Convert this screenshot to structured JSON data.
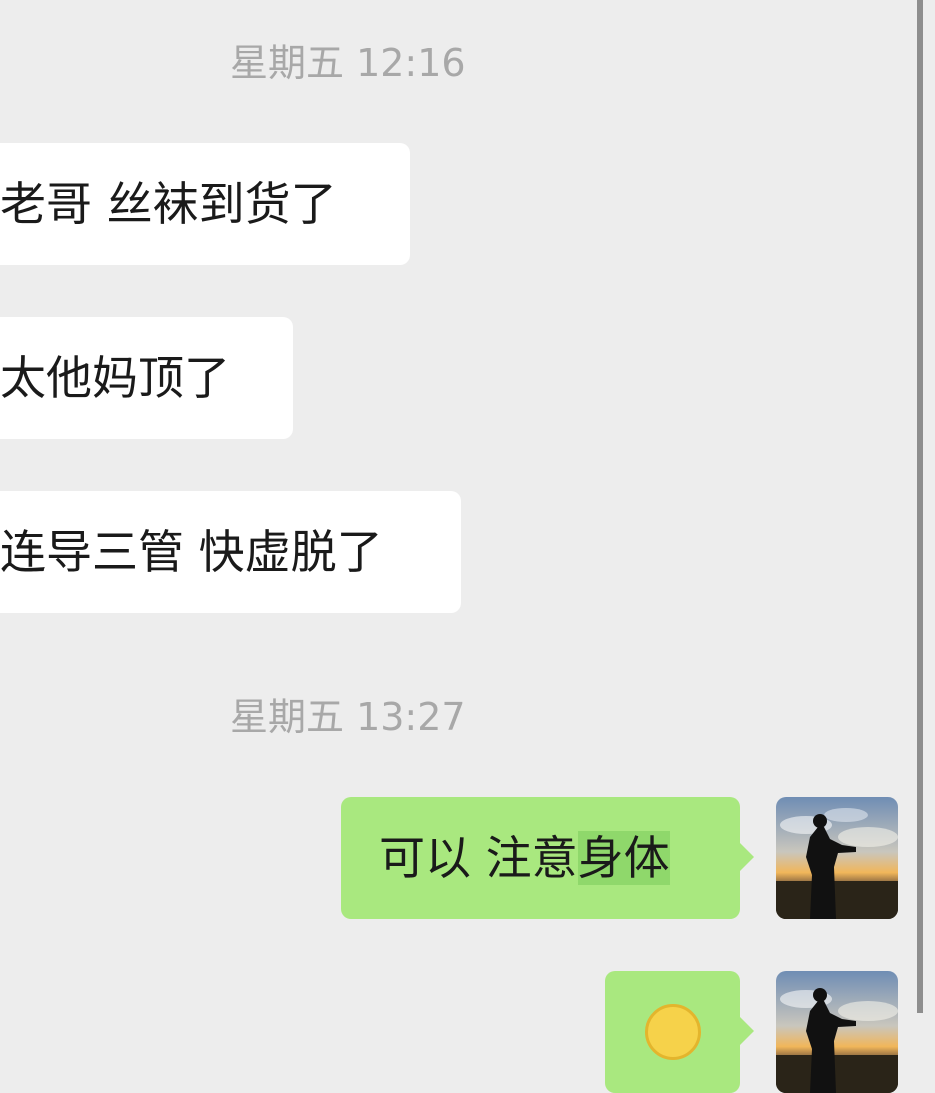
{
  "timestamps": {
    "first": "星期五 12:16",
    "second": "星期五 13:27"
  },
  "messages": {
    "incoming": [
      "老哥 丝袜到货了",
      "太他妈顶了",
      "连导三管 快虚脱了"
    ],
    "outgoing": {
      "text_plain": "可以 注意",
      "text_selected": "身体"
    }
  },
  "avatar": {
    "icon": "sunset-silhouette-avatar"
  },
  "colors": {
    "background": "#ededed",
    "incoming_bubble": "#ffffff",
    "outgoing_bubble": "#a9e87f",
    "selection_highlight": "#8fd86b",
    "timestamp_text": "#a8a8a8"
  }
}
